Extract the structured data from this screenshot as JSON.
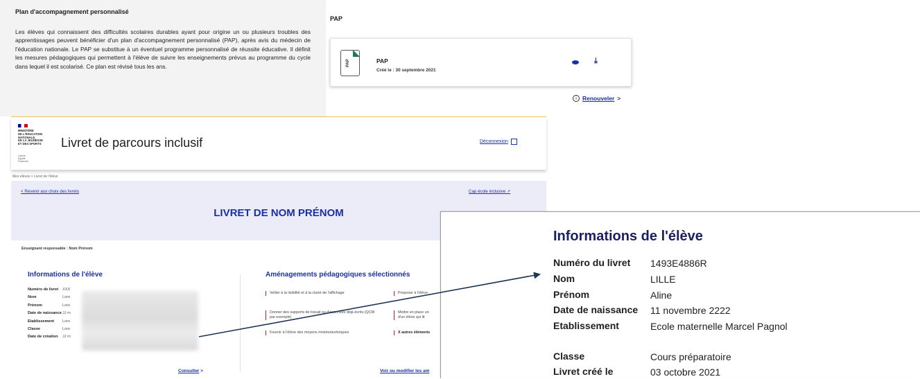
{
  "pap_panel": {
    "title": "Plan d'accompagnement personnalisé",
    "body": "Les élèves qui connaissent des difficultés scolaires durables ayant pour origine un ou plusieurs troubles des apprentissages peuvent bénéficier d'un plan d'accompagnement personnalisé (PAP), après avis du médecin de l'éducation nationale. Le PAP se substitue à un éventuel programme personnalisé de réussite éducative. Il définit les mesures pédagogiques qui permettent à l'élève de suivre les enseignements prévus au programme du cycle dans lequel il est scolarisé. Ce plan est révisé tous les ans."
  },
  "pap_doc": {
    "section_title": "PAP",
    "icon_text": "PAP",
    "file_name": "PAP",
    "created": "Créé le : 30 septembre 2021",
    "view_icon": "eye-icon",
    "download_icon": "download-icon",
    "renew_label": "Renouveler",
    "renew_chevron": ">"
  },
  "app": {
    "ministry": "MINISTÈRE\nDE L'ÉDUCATION\nNATIONALE,\nDE LA JEUNESSE\nET DES SPORTS",
    "motto": "Liberté\nÉgalité\nFraternité",
    "title": "Livret de parcours inclusif",
    "logout": "Déconnexion",
    "breadcrumb": "Mes élèves  >  Livret de l'élève",
    "back_link": "< Revenir aux choix des livrets",
    "cap_link": "Cap école inclusive ↗",
    "livret_title": "LIVRET DE NOM PRÉNOM",
    "teacher_label": "Enseignant responsable :",
    "teacher_name": "Nom Prénom",
    "infos_title": "Informations de l'élève",
    "infos_rows": [
      {
        "k": "Numéro de livret",
        "v": "XXX"
      },
      {
        "k": "Nom",
        "v": "Lore"
      },
      {
        "k": "Prénom",
        "v": "Lore"
      },
      {
        "k": "Date de naissance",
        "v": "JJ m"
      },
      {
        "k": "Etablissement",
        "v": "Lore"
      },
      {
        "k": "Classe",
        "v": "Lore"
      },
      {
        "k": "Date de création",
        "v": "JJ m"
      }
    ],
    "consult": "Consulter",
    "consult_chevron": ">",
    "amenag_title": "Aménagements pédagogiques sélectionnés",
    "amenag_items": [
      "Veiller à la lisibilité et à la clarté de l'affichage",
      "Proposer à l'élève",
      "Donner des supports de travail ou d'exercices déjà écrits (QCM par exemple)",
      "Mettre en place un\nd'un élève qui lit",
      "Fournir à l'élève des moyens mnémotechniques",
      "X autres éléments"
    ],
    "modify_link": "Voir ou modifier les am"
  },
  "zoom": {
    "title": "Informations de l'élève",
    "rows": [
      {
        "k": "Numéro du livret",
        "v": "1493E4886R"
      },
      {
        "k": "Nom",
        "v": "LILLE"
      },
      {
        "k": "Prénom",
        "v": "Aline"
      },
      {
        "k": "Date de naissance",
        "v": "11 novembre 2222"
      },
      {
        "k": "Etablissement",
        "v": "Ecole maternelle Marcel Pagnol"
      },
      {
        "k": "Classe",
        "v": "Cours préparatoire"
      },
      {
        "k": "Livret créé le",
        "v": "03 octobre 2021"
      }
    ]
  },
  "colors": {
    "accent": "#1b2fa6",
    "title_dark": "#1b2060",
    "hero_bg": "#ececf8",
    "marker_red": "#c9191e"
  }
}
